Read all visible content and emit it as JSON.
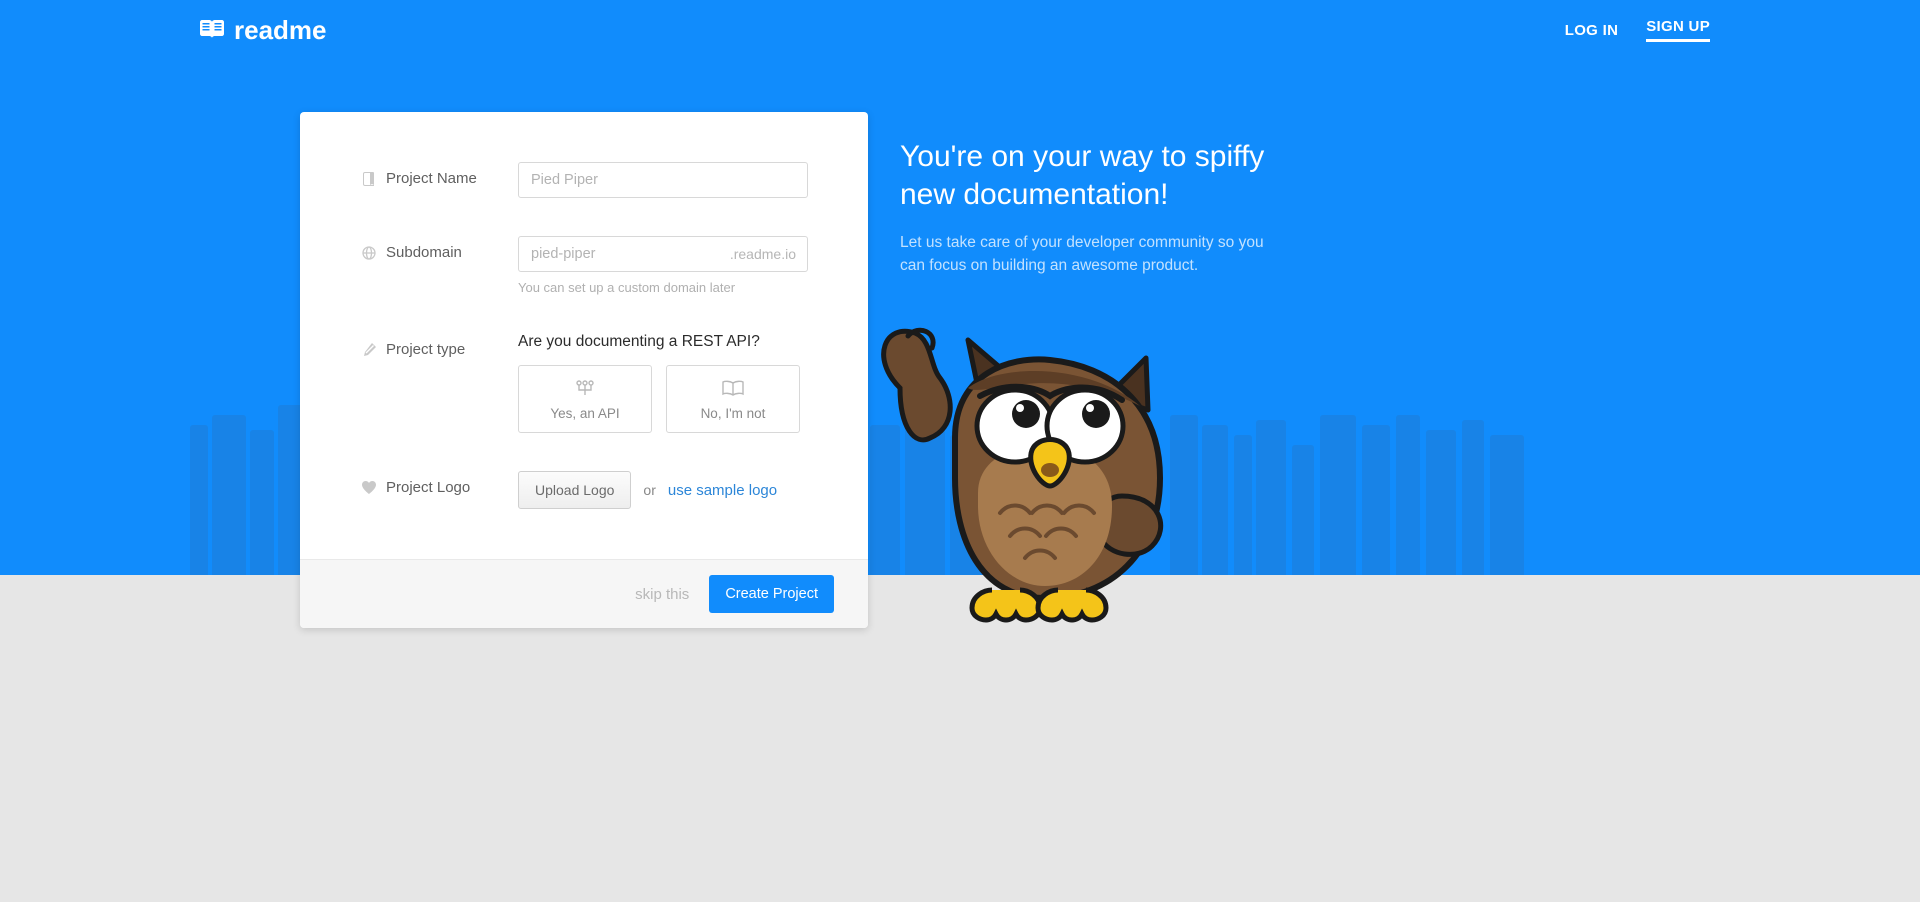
{
  "brand": "readme",
  "nav": {
    "login": "LOG IN",
    "signup": "SIGN UP"
  },
  "blurb": {
    "title": "You're on your way to spiffy new documentation!",
    "body": "Let us take care of your developer community so you can focus on building an awesome product."
  },
  "form": {
    "project_name": {
      "label": "Project Name",
      "placeholder": "Pied Piper"
    },
    "subdomain": {
      "label": "Subdomain",
      "placeholder": "pied-piper",
      "suffix": ".readme.io",
      "hint": "You can set up a custom domain later"
    },
    "project_type": {
      "label": "Project type",
      "question": "Are you documenting a REST API?",
      "yes": "Yes, an API",
      "no": "No, I'm not"
    },
    "logo": {
      "label": "Project Logo",
      "upload": "Upload Logo",
      "or": "or",
      "sample": "use sample logo"
    }
  },
  "footer": {
    "skip": "skip this",
    "create": "Create Project"
  }
}
